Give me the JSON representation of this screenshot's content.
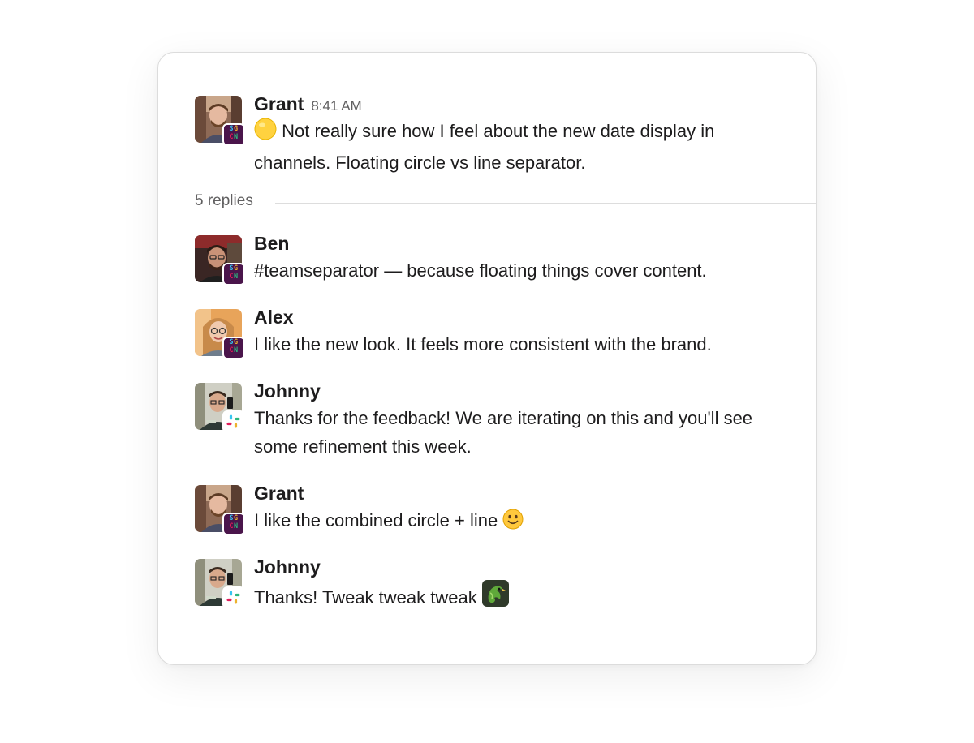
{
  "thread": {
    "parent": {
      "author": "Grant",
      "time": "8:41 AM",
      "text": "Not really sure how I feel about the new date display in channels. Floating circle vs line separator."
    },
    "reply_count": "5 replies",
    "replies": [
      {
        "author": "Ben",
        "text": "#teamseparator — because floating things cover content."
      },
      {
        "author": "Alex",
        "text": "I like the new look. It feels more consistent with the brand."
      },
      {
        "author": "Johnny",
        "text": "Thanks for the feedback! We are iterating on this and you'll see some refinement this week."
      },
      {
        "author": "Grant",
        "text": "I like the combined circle + line"
      },
      {
        "author": "Johnny",
        "text": "Thanks! Tweak tweak tweak"
      }
    ]
  },
  "badges": {
    "workspace": {
      "line1": "SG",
      "line2": "CN"
    }
  },
  "icons": {
    "status": "yellow-circle-emoji",
    "smile": "slightly-smiling-face-emoji",
    "parrot": "parrot-emoji",
    "slack": "slack-logo"
  },
  "colors": {
    "text": "#1d1c1d",
    "secondary": "#616061",
    "badge_bg": "#4a154b",
    "border": "#dcdcdc"
  }
}
